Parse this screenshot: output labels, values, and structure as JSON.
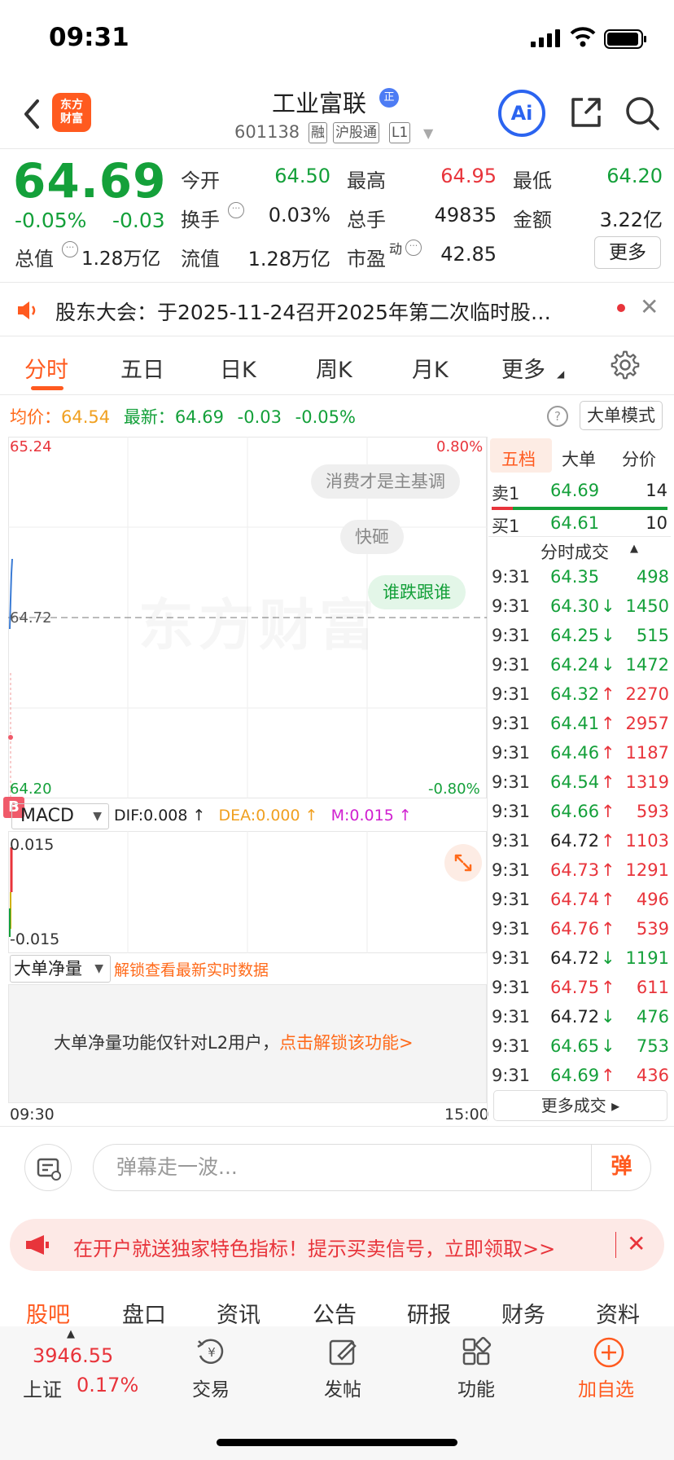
{
  "status_bar": {
    "time": "09:31"
  },
  "header": {
    "logo_line1": "东方",
    "logo_line2": "财富",
    "stock_name": "工业富联",
    "badge": "正",
    "stock_code": "601138",
    "tags": [
      "融",
      "沪股通",
      "L1"
    ]
  },
  "quote": {
    "price": "64.69",
    "pct_change": "-0.05%",
    "change": "-0.03",
    "rows": [
      [
        {
          "label": "今开",
          "value": "64.50",
          "color": "green"
        },
        {
          "label": "最高",
          "value": "64.95",
          "color": "red"
        },
        {
          "label": "最低",
          "value": "64.20",
          "color": "green"
        }
      ],
      [
        {
          "label": "换手",
          "value": "0.03%",
          "color": "black"
        },
        {
          "label": "总手",
          "value": "49835",
          "color": "black"
        },
        {
          "label": "金额",
          "value": "3.22亿",
          "color": "black"
        }
      ],
      [
        {
          "label": "总值",
          "value": "1.28万亿",
          "color": "black"
        },
        {
          "label": "流值",
          "value": "1.28万亿",
          "color": "black"
        },
        {
          "label": "市盈",
          "sup": "动",
          "value": "42.85",
          "color": "black"
        }
      ]
    ],
    "more_label": "更多"
  },
  "notice": {
    "text": "股东大会：于2025-11-24召开2025年第二次临时股…"
  },
  "period_tabs": [
    "分时",
    "五日",
    "日K",
    "周K",
    "月K",
    "更多"
  ],
  "info_row": {
    "avg_label": "均价：",
    "avg_value": "64.54",
    "latest_label": "最新：",
    "latest_value": "64.69",
    "latest_change": "-0.03",
    "latest_pct": "-0.05%",
    "help": "?",
    "mode_button": "大单模式"
  },
  "chart": {
    "y_top": "65.24",
    "y_bottom": "64.20",
    "y_mid": "64.72",
    "pct_top": "0.80%",
    "pct_bottom": "-0.80%",
    "watermark": "东方财富",
    "danmu": [
      "消费才是主基调",
      "快砸",
      "谁跌跟谁"
    ]
  },
  "macd": {
    "badge": "B",
    "select": "MACD",
    "dif": "DIF:0.008 ↑",
    "dea": "DEA:0.000 ↑",
    "m": "M:0.015 ↑",
    "y_top": "0.015",
    "y_bottom": "-0.015"
  },
  "big_order": {
    "select": "大单净量",
    "unlock": "解锁查看最新实时数据",
    "msg_prefix": "大单净量功能仅针对L2用户，",
    "msg_link": "点击解锁该功能>"
  },
  "time_axis": {
    "start": "09:30",
    "end": "15:00"
  },
  "right_panel": {
    "tabs": [
      "五档",
      "大单",
      "分价"
    ],
    "sell1": {
      "label": "卖1",
      "price": "64.69",
      "vol": "14"
    },
    "buy1": {
      "label": "买1",
      "price": "64.61",
      "vol": "10"
    },
    "ticks_title": "分时成交",
    "ticks": [
      {
        "t": "9:31",
        "p": "64.35",
        "d": "",
        "v": "498",
        "pc": "green",
        "vc": "green"
      },
      {
        "t": "9:31",
        "p": "64.30",
        "d": "↓",
        "v": "1450",
        "pc": "green",
        "vc": "green"
      },
      {
        "t": "9:31",
        "p": "64.25",
        "d": "↓",
        "v": "515",
        "pc": "green",
        "vc": "green"
      },
      {
        "t": "9:31",
        "p": "64.24",
        "d": "↓",
        "v": "1472",
        "pc": "green",
        "vc": "green"
      },
      {
        "t": "9:31",
        "p": "64.32",
        "d": "↑",
        "v": "2270",
        "pc": "green",
        "vc": "red"
      },
      {
        "t": "9:31",
        "p": "64.41",
        "d": "↑",
        "v": "2957",
        "pc": "green",
        "vc": "red"
      },
      {
        "t": "9:31",
        "p": "64.46",
        "d": "↑",
        "v": "1187",
        "pc": "green",
        "vc": "red"
      },
      {
        "t": "9:31",
        "p": "64.54",
        "d": "↑",
        "v": "1319",
        "pc": "green",
        "vc": "red"
      },
      {
        "t": "9:31",
        "p": "64.66",
        "d": "↑",
        "v": "593",
        "pc": "green",
        "vc": "red"
      },
      {
        "t": "9:31",
        "p": "64.72",
        "d": "↑",
        "v": "1103",
        "pc": "black",
        "vc": "red"
      },
      {
        "t": "9:31",
        "p": "64.73",
        "d": "↑",
        "v": "1291",
        "pc": "red",
        "vc": "red"
      },
      {
        "t": "9:31",
        "p": "64.74",
        "d": "↑",
        "v": "496",
        "pc": "red",
        "vc": "red"
      },
      {
        "t": "9:31",
        "p": "64.76",
        "d": "↑",
        "v": "539",
        "pc": "red",
        "vc": "red"
      },
      {
        "t": "9:31",
        "p": "64.72",
        "d": "↓",
        "v": "1191",
        "pc": "black",
        "vc": "green"
      },
      {
        "t": "9:31",
        "p": "64.75",
        "d": "↑",
        "v": "611",
        "pc": "red",
        "vc": "red"
      },
      {
        "t": "9:31",
        "p": "64.72",
        "d": "↓",
        "v": "476",
        "pc": "black",
        "vc": "green"
      },
      {
        "t": "9:31",
        "p": "64.65",
        "d": "↓",
        "v": "753",
        "pc": "green",
        "vc": "green"
      },
      {
        "t": "9:31",
        "p": "64.69",
        "d": "↑",
        "v": "436",
        "pc": "green",
        "vc": "red"
      }
    ],
    "more_trades": "更多成交 ▸"
  },
  "comment_bar": {
    "placeholder": "弹幕走一波...",
    "danmu_button": "弹"
  },
  "promo": {
    "text": "在开户就送独家特色指标！提示买卖信号，立即领取>>",
    "close": "✕"
  },
  "bottom_tabs": [
    "股吧",
    "盘口",
    "资讯",
    "公告",
    "研报",
    "财务",
    "资料"
  ],
  "bottom_nav": {
    "index_value": "3946.55",
    "index_name": "上证",
    "index_pct": "0.17%",
    "items": [
      "交易",
      "发帖",
      "功能",
      "加自选"
    ]
  },
  "colors": {
    "up": "#e8343b",
    "down": "#14a03a",
    "brand": "#ff5a1f",
    "ai": "#2b64f0"
  }
}
